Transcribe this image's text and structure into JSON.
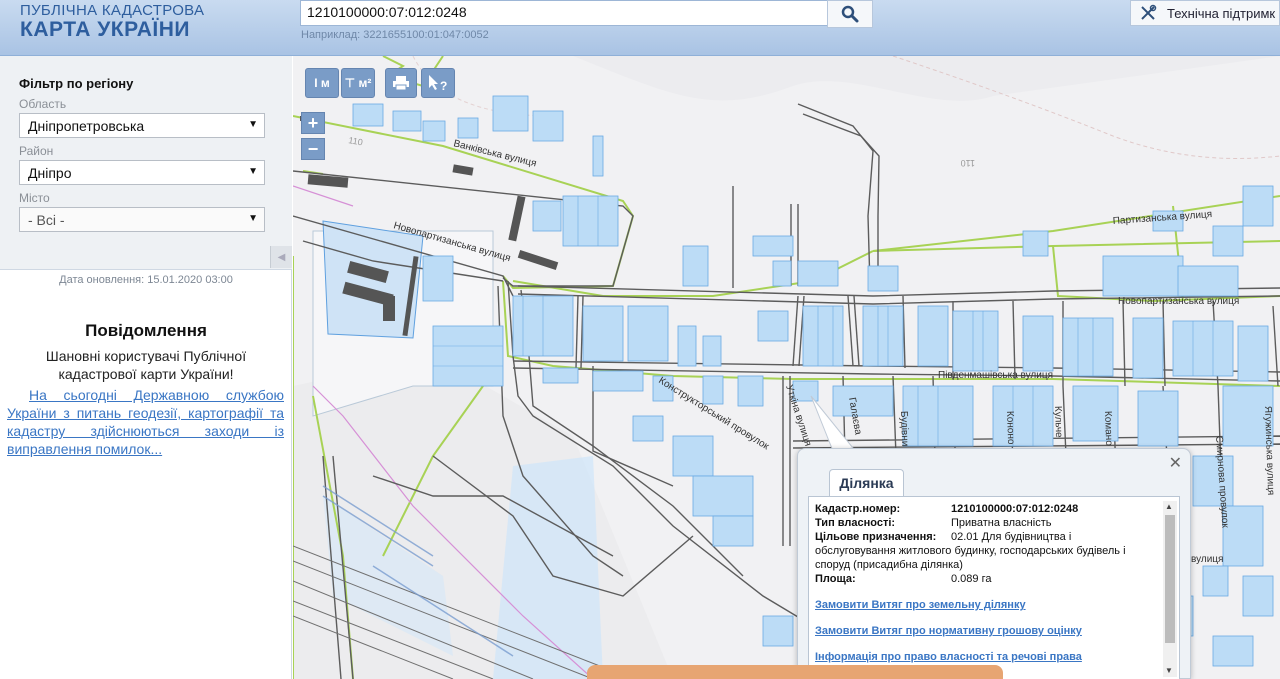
{
  "header": {
    "logo_line1": "ПУБЛІЧНА КАДАСТРОВА",
    "logo_line2": "КАРТА УКРАЇНИ",
    "search_value": "1210100000:07:012:0248",
    "search_hint": "Наприклад: 3221655100:01:047:0052",
    "support_label": "Технічна підтримк"
  },
  "sidebar": {
    "filter_title": "Фільтр по регіону",
    "oblast_label": "Область",
    "oblast_value": "Дніпропетровська",
    "rayon_label": "Район",
    "rayon_value": "Дніпро",
    "misto_label": "Місто",
    "misto_value": "- Всі -",
    "updated": "Дата оновлення: 15.01.2020 03:00",
    "notice_title": "Повідомлення",
    "notice_text": "Шановні користувачі Публічної кадастрової карти України!",
    "notice_link": "На сьогодні Державною службою України з питань геодезії, картографії та кадастру здійснюються заходи із виправлення помилок..."
  },
  "map": {
    "toolbar": [
      "I м",
      "⊤ м²"
    ],
    "zoom_in": "+",
    "zoom_out": "−",
    "streets": {
      "s1": "Ванківська вулиця",
      "s2": "Новопартизанська вулиця",
      "s3": "Партизанська вулиця",
      "s4": "Новопартизанська вулиця",
      "s5": "Південмашівська вулиця",
      "s6": "Конструкторський провулок",
      "s7": "Уткіна вулиця",
      "s8": "Галаєва",
      "s9": "Будівни",
      "s10": "Кононо",
      "s11": "Кульче",
      "s12": "Комано",
      "s13": "Смирнова провулок",
      "s14": "Ягужинська вулиця",
      "s15": "вулиця",
      "c1": "110",
      "c2": "110"
    }
  },
  "popup": {
    "tab": "Ділянка",
    "k_cadastral": "Кадастр.номер:",
    "v_cadastral": "1210100000:07:012:0248",
    "k_ownership": "Тип власності:",
    "v_ownership": "Приватна власність",
    "k_purpose": "Цільове призначення:",
    "v_purpose_1": "02.01 Для будівництва і",
    "v_purpose_2": "обслуговування житлового будинку, господарських будівель і",
    "v_purpose_3": "споруд (присадибна ділянка)",
    "k_area": "Площа:",
    "v_area": "0.089 га",
    "link1": "Замовити Витяг про земельну ділянку",
    "link2": "Замовити Витяг про нормативну грошову оцінку",
    "link3": "Інформація про право власності та речові права"
  },
  "colors": {
    "header": "#b9cfea",
    "toolbar": "#7a9cc7",
    "parcel": "#bcdcf6",
    "road_green": "#9fcf4a",
    "link": "#3a76c4"
  }
}
